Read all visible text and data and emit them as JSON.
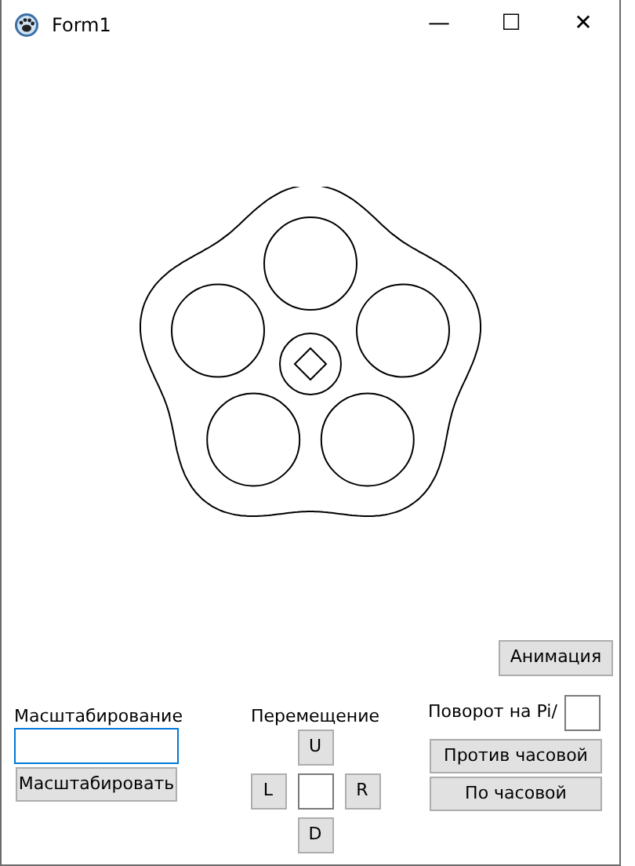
{
  "window": {
    "title": "Form1",
    "controls": [
      "—",
      "☐",
      "✕"
    ]
  },
  "animation_button": "Анимация",
  "scale": {
    "label": "Масштабирование",
    "input": {
      "focused": true
    },
    "button": "Масштабировать"
  },
  "move": {
    "label": "Перемещение",
    "up": "U",
    "left": "L",
    "right": "R",
    "down": "D"
  },
  "rotate": {
    "label": "Поворот на Pi/",
    "counterclockwise": "Против часовой",
    "clockwise": "По часовой"
  }
}
